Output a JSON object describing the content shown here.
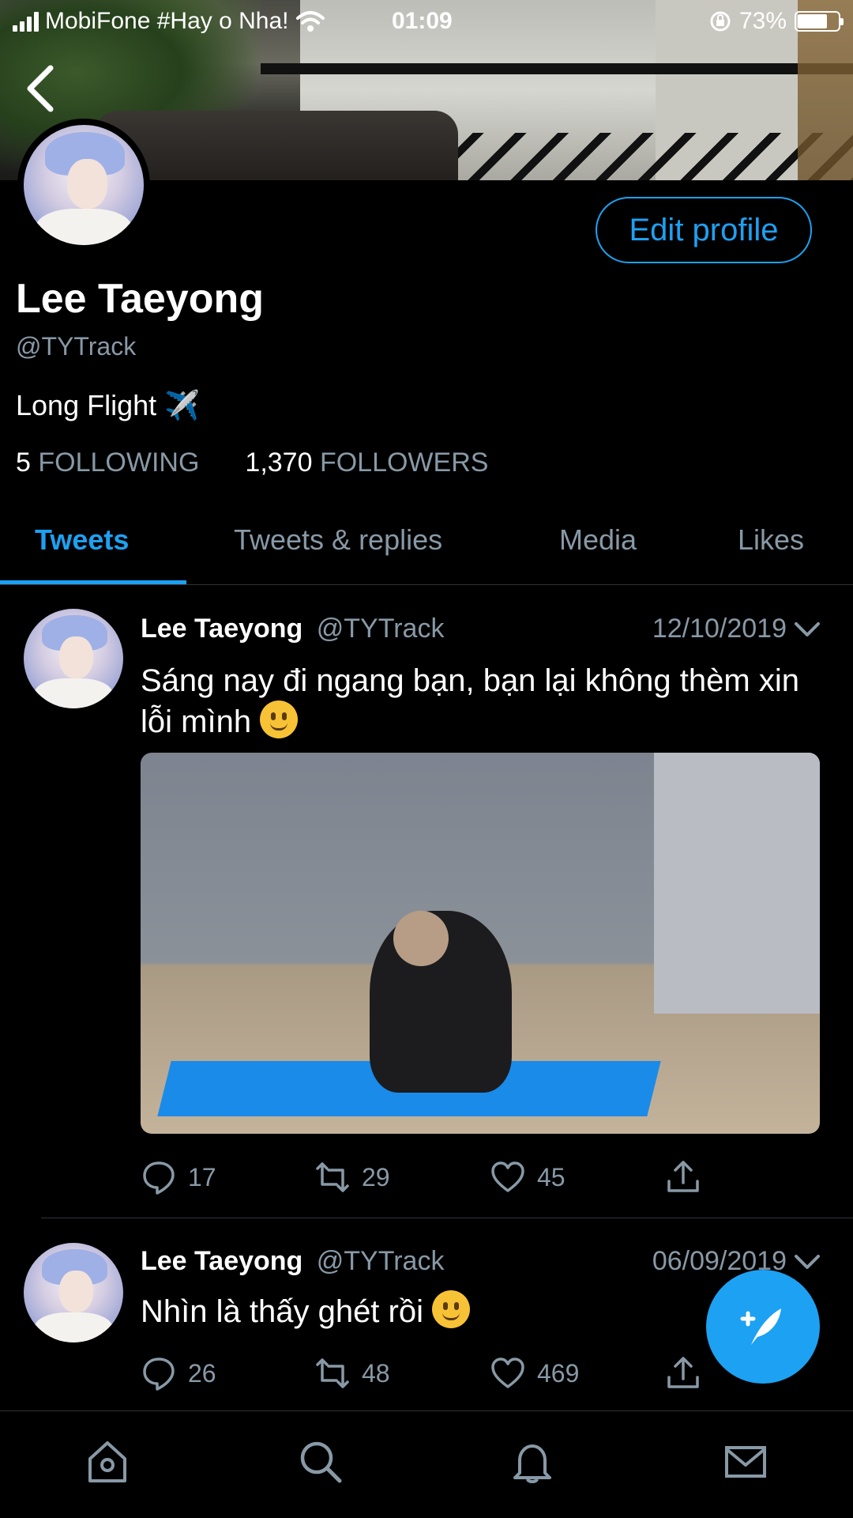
{
  "status_bar": {
    "carrier": "MobiFone #Hay o Nha!",
    "time": "01:09",
    "battery": "73%",
    "battery_level": 0.73
  },
  "profile": {
    "name": "Lee Taeyong",
    "handle": "@TYTrack",
    "bio": "Long Flight ✈️",
    "following_count": "5",
    "following_label": "FOLLOWING",
    "followers_count": "1,370",
    "followers_label": "FOLLOWERS",
    "edit_button": "Edit profile"
  },
  "tabs": [
    {
      "label": "Tweets",
      "active": true
    },
    {
      "label": "Tweets & replies",
      "active": false
    },
    {
      "label": "Media",
      "active": false
    },
    {
      "label": "Likes",
      "active": false
    }
  ],
  "tweets": [
    {
      "name": "Lee Taeyong",
      "handle": "@TYTrack",
      "date": "12/10/2019",
      "text": "Sáng nay đi ngang bạn, bạn lại không thèm xin lỗi mình",
      "replies": "17",
      "retweets": "29",
      "likes": "45"
    },
    {
      "name": "Lee Taeyong",
      "handle": "@TYTrack",
      "date": "06/09/2019",
      "text": "Nhìn là thấy ghét rồi",
      "replies": "26",
      "retweets": "48",
      "likes": "469"
    }
  ],
  "icons": {
    "back": "chevron-left-icon",
    "reply": "reply-icon",
    "retweet": "retweet-icon",
    "like": "heart-icon",
    "share": "share-icon",
    "compose": "compose-tweet-icon",
    "home": "home-icon",
    "search": "search-icon",
    "notifications": "bell-icon",
    "messages": "mail-icon"
  },
  "colors": {
    "accent": "#1da1f2",
    "background": "#000000",
    "secondary_text": "#8899a6"
  }
}
